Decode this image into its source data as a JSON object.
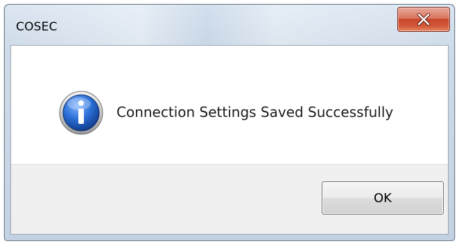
{
  "window": {
    "title": "COSEC"
  },
  "titlebar": {
    "close_icon": "close-icon",
    "close_button_color": "#c6462c"
  },
  "dialog": {
    "icon": "info-icon",
    "icon_color": "#1f5fbf",
    "message": "Connection Settings Saved Successfully",
    "ok_label": "OK"
  }
}
